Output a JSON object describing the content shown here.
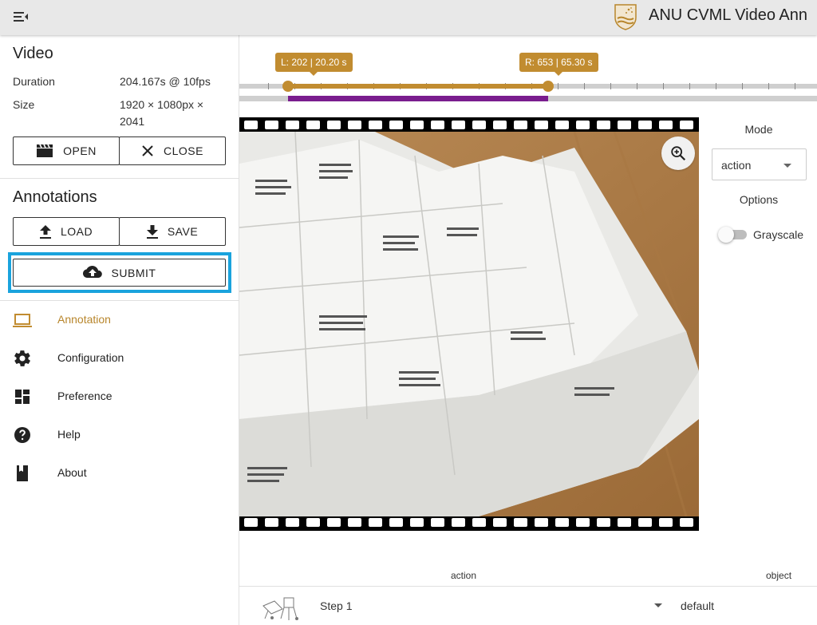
{
  "app": {
    "title": "ANU CVML Video Ann"
  },
  "video": {
    "heading": "Video",
    "duration_label": "Duration",
    "duration_value": "204.167s @ 10fps",
    "size_label": "Size",
    "size_value": "1920 × 1080px × 2041",
    "open_label": "OPEN",
    "close_label": "CLOSE"
  },
  "annotations": {
    "heading": "Annotations",
    "load_label": "LOAD",
    "save_label": "SAVE",
    "submit_label": "SUBMIT"
  },
  "nav": [
    {
      "label": "Annotation",
      "icon": "laptop-icon",
      "active": true
    },
    {
      "label": "Configuration",
      "icon": "gear-icon"
    },
    {
      "label": "Preference",
      "icon": "dashboard-icon"
    },
    {
      "label": "Help",
      "icon": "help-icon"
    },
    {
      "label": "About",
      "icon": "book-icon"
    }
  ],
  "timeline": {
    "left_label": "L: 202 | 20.20 s",
    "right_label": "R: 653 | 65.30 s",
    "left_frame": 202,
    "right_frame": 653
  },
  "panel": {
    "mode_label": "Mode",
    "mode_value": "action",
    "options_label": "Options",
    "grayscale_label": "Grayscale",
    "grayscale_on": false
  },
  "table": {
    "col_action": "action",
    "col_object": "object",
    "rows": [
      {
        "step": "Step 1",
        "object": "default"
      }
    ]
  },
  "colors": {
    "accent": "#c18c30",
    "highlight": "#1aa3dd",
    "range_bar": "#7a1d8e"
  }
}
